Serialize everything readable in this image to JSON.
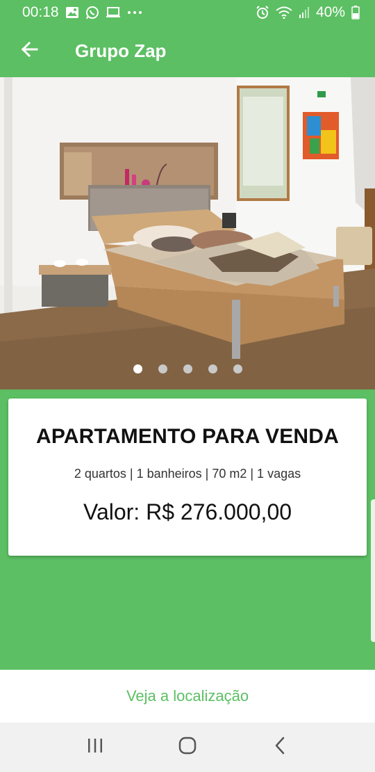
{
  "status_bar": {
    "time": "00:18",
    "battery": "40%",
    "left_icons": [
      "image-icon",
      "whatsapp-icon",
      "laptop-icon",
      "more-icon"
    ],
    "right_icons": [
      "alarm-icon",
      "wifi-icon",
      "signal-icon",
      "battery-icon"
    ]
  },
  "app_bar": {
    "title": "Grupo Zap",
    "back_icon": "arrow-left-icon"
  },
  "carousel": {
    "image": "bedroom-photo",
    "page_count": 5,
    "active_index": 0
  },
  "listing": {
    "title": "APARTAMENTO PARA VENDA",
    "details": "2 quartos | 1 banheiros | 70 m2 | 1 vagas",
    "price": "Valor: R$ 276.000,00"
  },
  "actions": {
    "location_label": "Veja a localização"
  },
  "nav_bar": {
    "items": [
      "recent-apps-icon",
      "home-icon",
      "back-icon"
    ]
  },
  "colors": {
    "accent": "#5cbf63",
    "card": "#ffffff",
    "nav": "#f1f1f1"
  }
}
